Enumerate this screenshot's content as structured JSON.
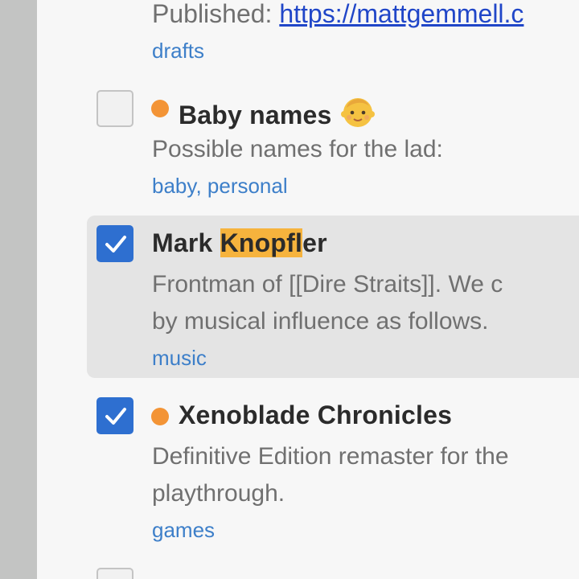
{
  "notes": [
    {
      "published_prefix": "Published: ",
      "published_link": "https://mattgemmell.c",
      "tags": "drafts"
    },
    {
      "title": "Baby names",
      "title_icon": "baby-face-icon",
      "preview": "Possible names for the lad:",
      "tags": "baby, personal",
      "checked": false,
      "dot_color": "#f39436"
    },
    {
      "title_before": "Mark ",
      "title_highlight": "Knopfl",
      "title_after": "er",
      "preview_line1": "Frontman of [[Dire Straits]]. We c",
      "preview_line2": "by musical influence as follows.",
      "tags": "music",
      "checked": true,
      "selected": true
    },
    {
      "title": "Xenoblade Chronicles",
      "preview_line1": "Definitive Edition remaster for the",
      "preview_line2": "playthrough.",
      "tags": "games",
      "checked": true,
      "dot_color": "#f39436"
    }
  ],
  "colors": {
    "accent": "#2e6fd0",
    "tag": "#3d7fc9",
    "highlight": "#f6b33d",
    "dot": "#f39436"
  }
}
